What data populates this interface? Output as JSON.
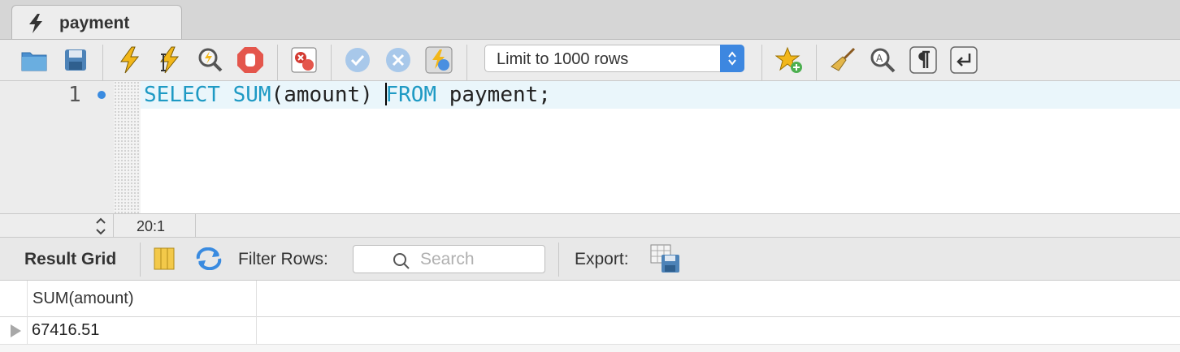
{
  "tab": {
    "title": "payment",
    "icon": "lightning-icon"
  },
  "toolbar": {
    "limit_select": {
      "selected": "Limit to 1000 rows"
    }
  },
  "editor": {
    "line_number": "1",
    "sql": {
      "kw1": "SELECT",
      "fn": "SUM",
      "arg": "(amount) ",
      "kw2": "FROM",
      "rest": " payment;"
    }
  },
  "status": {
    "cursor_position": "20:1"
  },
  "result_toolbar": {
    "result_grid_label": "Result Grid",
    "filter_rows_label": "Filter Rows:",
    "search_placeholder": "Search",
    "export_label": "Export:"
  },
  "grid": {
    "columns": [
      "SUM(amount)"
    ],
    "rows": [
      [
        "67416.51"
      ]
    ]
  },
  "colors": {
    "keyword": "#1e9ac4",
    "accent": "#3d87e0"
  }
}
